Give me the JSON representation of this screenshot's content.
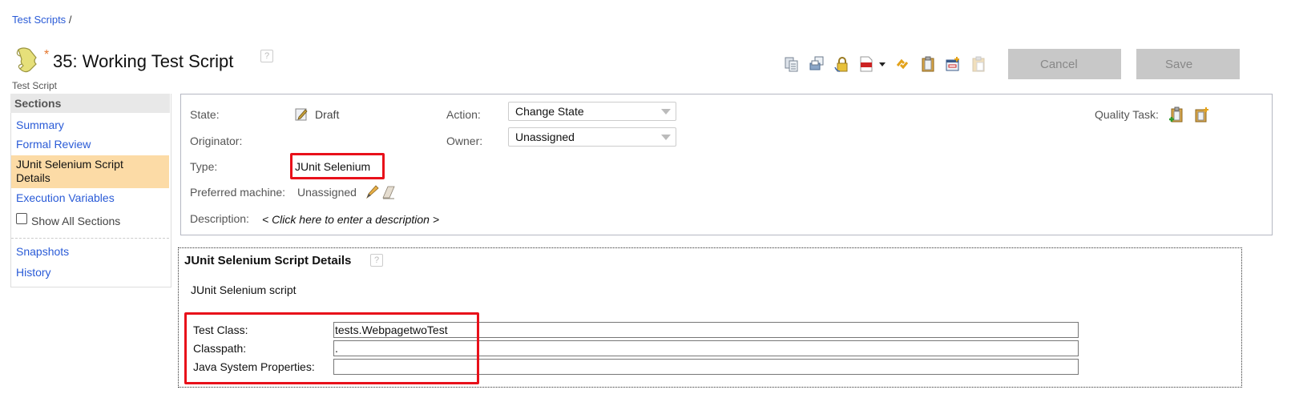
{
  "breadcrumb": {
    "link": "Test Scripts",
    "separator": "/"
  },
  "header": {
    "dirty_marker": "*",
    "title": "35:  Working Test Script",
    "subtitle": "Test Script",
    "help_glyph": "?"
  },
  "toolbar": {
    "icons": [
      "copy-icon",
      "print-icon",
      "lock-icon",
      "pdf-icon",
      "pdf-dropdown-icon",
      "sync-icon",
      "clipboard-icon",
      "new-window-icon",
      "paste-icon"
    ],
    "cancel_label": "Cancel",
    "save_label": "Save"
  },
  "sidebar": {
    "heading": "Sections",
    "items": [
      {
        "label": "Summary"
      },
      {
        "label": "Formal Review"
      },
      {
        "label": "JUnit Selenium Script Details",
        "active": true
      },
      {
        "label": "Execution Variables"
      }
    ],
    "show_all_label": "Show All Sections",
    "show_all_checked": false,
    "extra_items": [
      {
        "label": "Snapshots"
      },
      {
        "label": "History"
      }
    ]
  },
  "summary": {
    "state_label": "State:",
    "state_value": "Draft",
    "originator_label": "Originator:",
    "type_label": "Type:",
    "type_value": "JUnit Selenium",
    "machine_label": "Preferred machine:",
    "machine_value": "Unassigned",
    "description_label": "Description:",
    "description_placeholder": "< Click here to enter a description >",
    "action_label": "Action:",
    "action_value": "Change State",
    "owner_label": "Owner:",
    "owner_value": "Unassigned",
    "quality_task_label": "Quality Task:"
  },
  "details": {
    "heading": "JUnit Selenium Script Details",
    "description": "JUnit Selenium script",
    "fields": [
      {
        "label": "Test Class:",
        "value": "tests.WebpagetwoTest"
      },
      {
        "label": "Classpath:",
        "value": "."
      },
      {
        "label": "Java System Properties:",
        "value": ""
      }
    ]
  },
  "colors": {
    "link": "#2a5bd7",
    "highlight": "#e8101a",
    "active_section": "#fcdba6",
    "disabled_button": "#c8c8c8"
  }
}
